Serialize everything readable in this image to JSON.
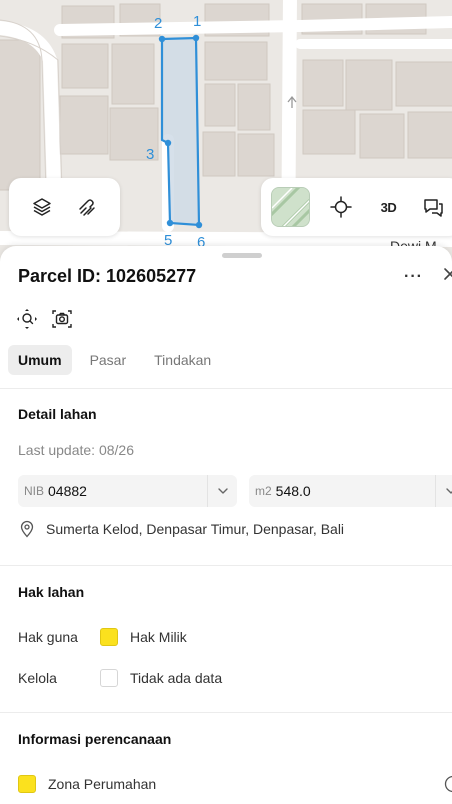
{
  "map": {
    "vertex_labels": [
      "1",
      "2",
      "3",
      "5",
      "6"
    ],
    "street_label": "Dewi M",
    "controls": {
      "layers": "layers-icon",
      "draw": "draw-icon",
      "satellite": "satellite-thumbnail",
      "locate": "crosshair-icon",
      "three_d_label": "3D",
      "chat": "chat-icon"
    },
    "colors": {
      "parcel_stroke": "#2f8fd8",
      "parcel_fill": "#cfdbe6",
      "road": "#ffffff",
      "building": "#d9d3cd"
    }
  },
  "sheet": {
    "title": "Parcel ID: 102605277",
    "more": "···",
    "tabs": [
      {
        "label": "Umum",
        "active": true
      },
      {
        "label": "Pasar",
        "active": false
      },
      {
        "label": "Tindakan",
        "active": false
      }
    ],
    "detail": {
      "title": "Detail lahan",
      "last_update": "Last update: 08/26",
      "nib_prefix": "NIB",
      "nib_value": "04882",
      "area_prefix": "m2",
      "area_value": "548.0",
      "address": "Sumerta Kelod, Denpasar Timur, Denpasar, Bali"
    },
    "rights": {
      "title": "Hak lahan",
      "rows": [
        {
          "label": "Hak guna",
          "value": "Hak Milik",
          "color": "#fbe11e"
        },
        {
          "label": "Kelola",
          "value": "Tidak ada data",
          "color": "#ffffff"
        }
      ]
    },
    "planning": {
      "title": "Informasi perencanaan",
      "zone": "Zona Perumahan",
      "zone_color": "#fbe11e"
    }
  }
}
